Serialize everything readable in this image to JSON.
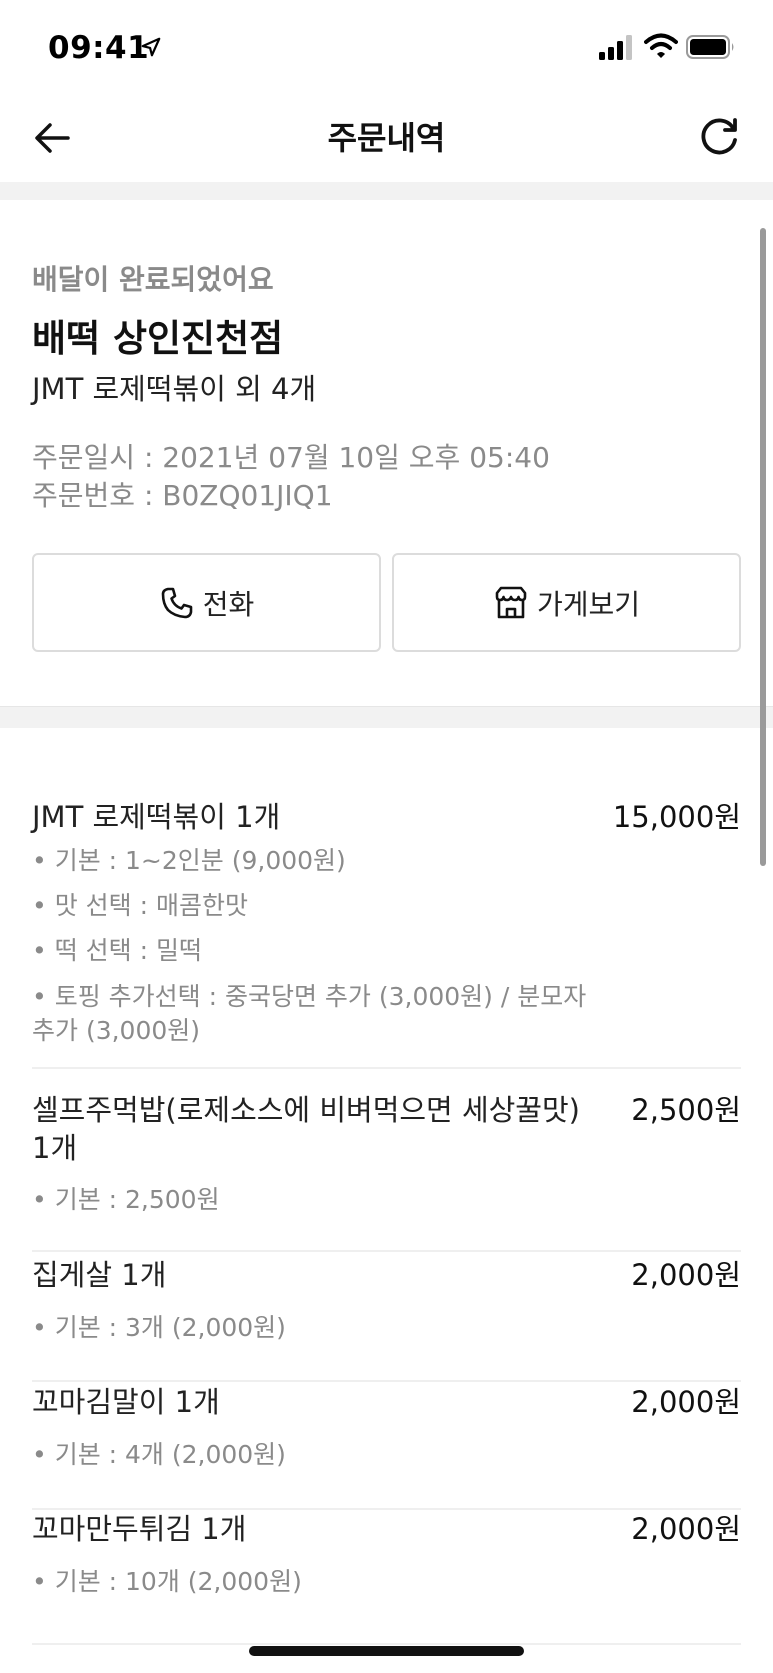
{
  "status_bar": {
    "time": "09:41"
  },
  "nav": {
    "title": "주문내역"
  },
  "summary": {
    "delivery_status": "배달이 완료되었어요",
    "store_name": "배떡 상인진천점",
    "order_summary": "JMT 로제떡볶이 외 4개",
    "order_date": "주문일시 : 2021년 07월 10일 오후 05:40",
    "order_number": "주문번호 : B0ZQ01JIQ1",
    "call_button": "전화",
    "store_button": "가게보기"
  },
  "items": [
    {
      "name": "JMT 로제떡볶이 1개",
      "price": "15,000원",
      "options": [
        "• 기본 : 1~2인분 (9,000원)",
        "• 맛 선택 : 매콤한맛",
        "• 떡 선택 : 밀떡",
        "• 토핑 추가선택 : 중국당면 추가 (3,000원) / 분모자 추가 (3,000원)"
      ]
    },
    {
      "name": "셀프주먹밥(로제소스에 비벼먹으면 세상꿀맛) 1개",
      "price": "2,500원",
      "options": [
        "• 기본 : 2,500원"
      ]
    },
    {
      "name": "집게살 1개",
      "price": "2,000원",
      "options": [
        "• 기본 : 3개 (2,000원)"
      ]
    },
    {
      "name": "꼬마김말이 1개",
      "price": "2,000원",
      "options": [
        "• 기본 : 4개 (2,000원)"
      ]
    },
    {
      "name": "꼬마만두튀김 1개",
      "price": "2,000원",
      "options": [
        "• 기본 : 10개 (2,000원)"
      ]
    }
  ],
  "icons": {
    "back": "arrow-left-icon",
    "refresh": "refresh-icon",
    "call": "phone-icon",
    "store": "store-icon"
  }
}
